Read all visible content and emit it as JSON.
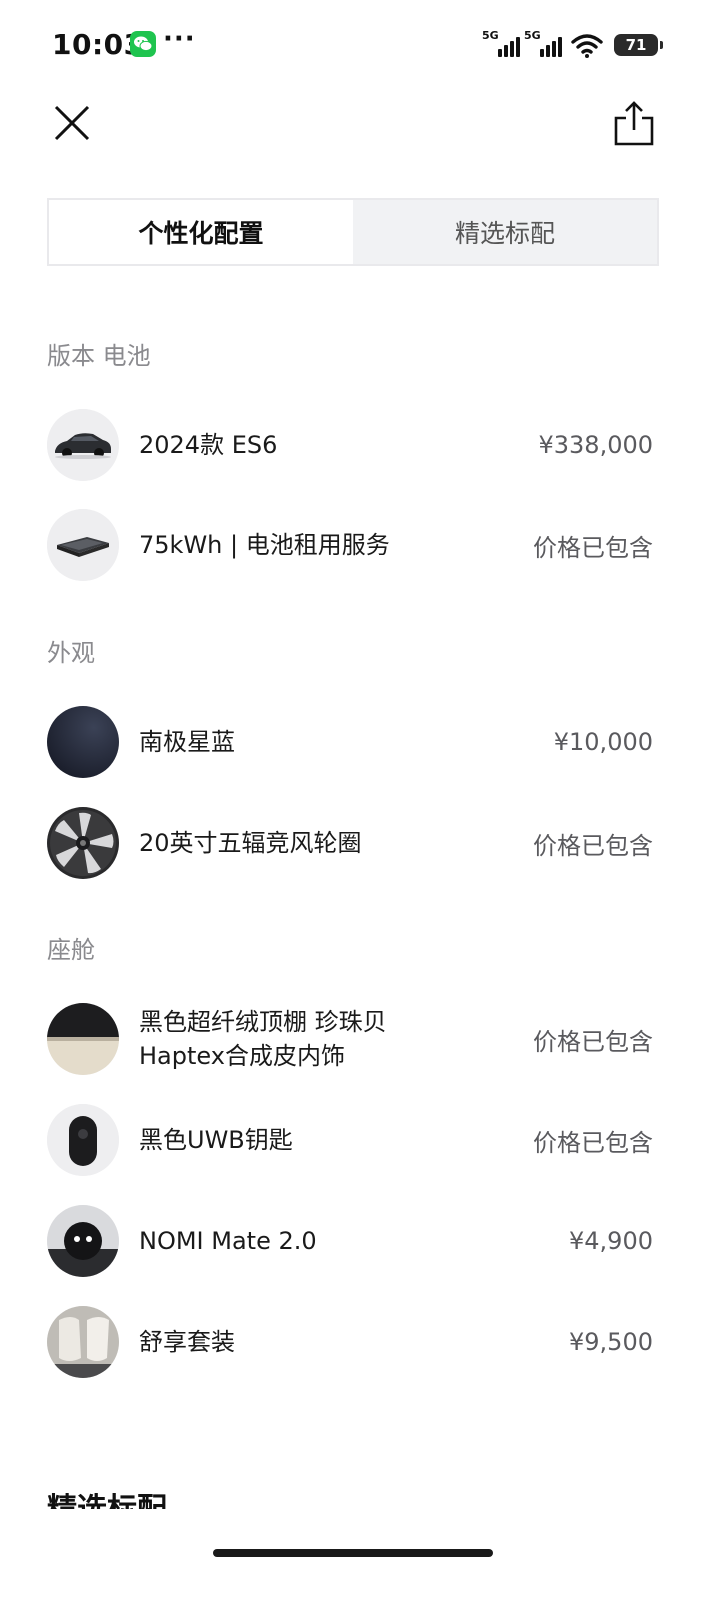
{
  "status_bar": {
    "time": "10:03",
    "more": "···",
    "signal1_tag": "5G",
    "signal2_tag": "5G",
    "battery": "71",
    "icons": [
      "wechat-icon",
      "cellular-signal-icon",
      "wifi-icon",
      "battery-icon"
    ]
  },
  "header": {
    "close_icon": "close-icon",
    "share_icon": "share-icon"
  },
  "tabs": [
    {
      "label": "个性化配置",
      "active": true
    },
    {
      "label": "精选标配",
      "active": false
    }
  ],
  "sections": {
    "version_battery": {
      "title": "版本 电池",
      "items": [
        {
          "name": "2024款 ES6",
          "price": "¥338,000",
          "thumb": "car-thumbnail"
        },
        {
          "name": "75kWh | 电池租用服务",
          "price": "价格已包含",
          "thumb": "battery-thumbnail"
        }
      ]
    },
    "exterior": {
      "title": "外观",
      "items": [
        {
          "name": "南极星蓝",
          "price": "¥10,000",
          "thumb": "paint-swatch",
          "color": "#1b1f2c"
        },
        {
          "name": "20英寸五辐竞风轮圈",
          "price": "价格已包含",
          "thumb": "wheel-thumbnail"
        }
      ]
    },
    "cabin": {
      "title": "座舱",
      "items": [
        {
          "name_line1": "黑色超纤绒顶棚 珍珠贝",
          "name_line2": "Haptex合成皮内饰",
          "price": "价格已包含",
          "thumb": "interior-swatch"
        },
        {
          "name": "黑色UWB钥匙",
          "price": "价格已包含",
          "thumb": "key-thumbnail"
        },
        {
          "name": "NOMI Mate 2.0",
          "price": "¥4,900",
          "thumb": "nomi-thumbnail"
        },
        {
          "name": "舒享套装",
          "price": "¥9,500",
          "thumb": "seat-thumbnail"
        }
      ]
    }
  },
  "bottom_peek_text": "精选标配",
  "colors": {
    "accent_text": "#1a1a1a",
    "muted_text": "#8a8a8e",
    "price_text": "#5a5a5e",
    "tab_inactive_bg": "#f1f2f4",
    "wechat_green": "#1fc44f"
  }
}
